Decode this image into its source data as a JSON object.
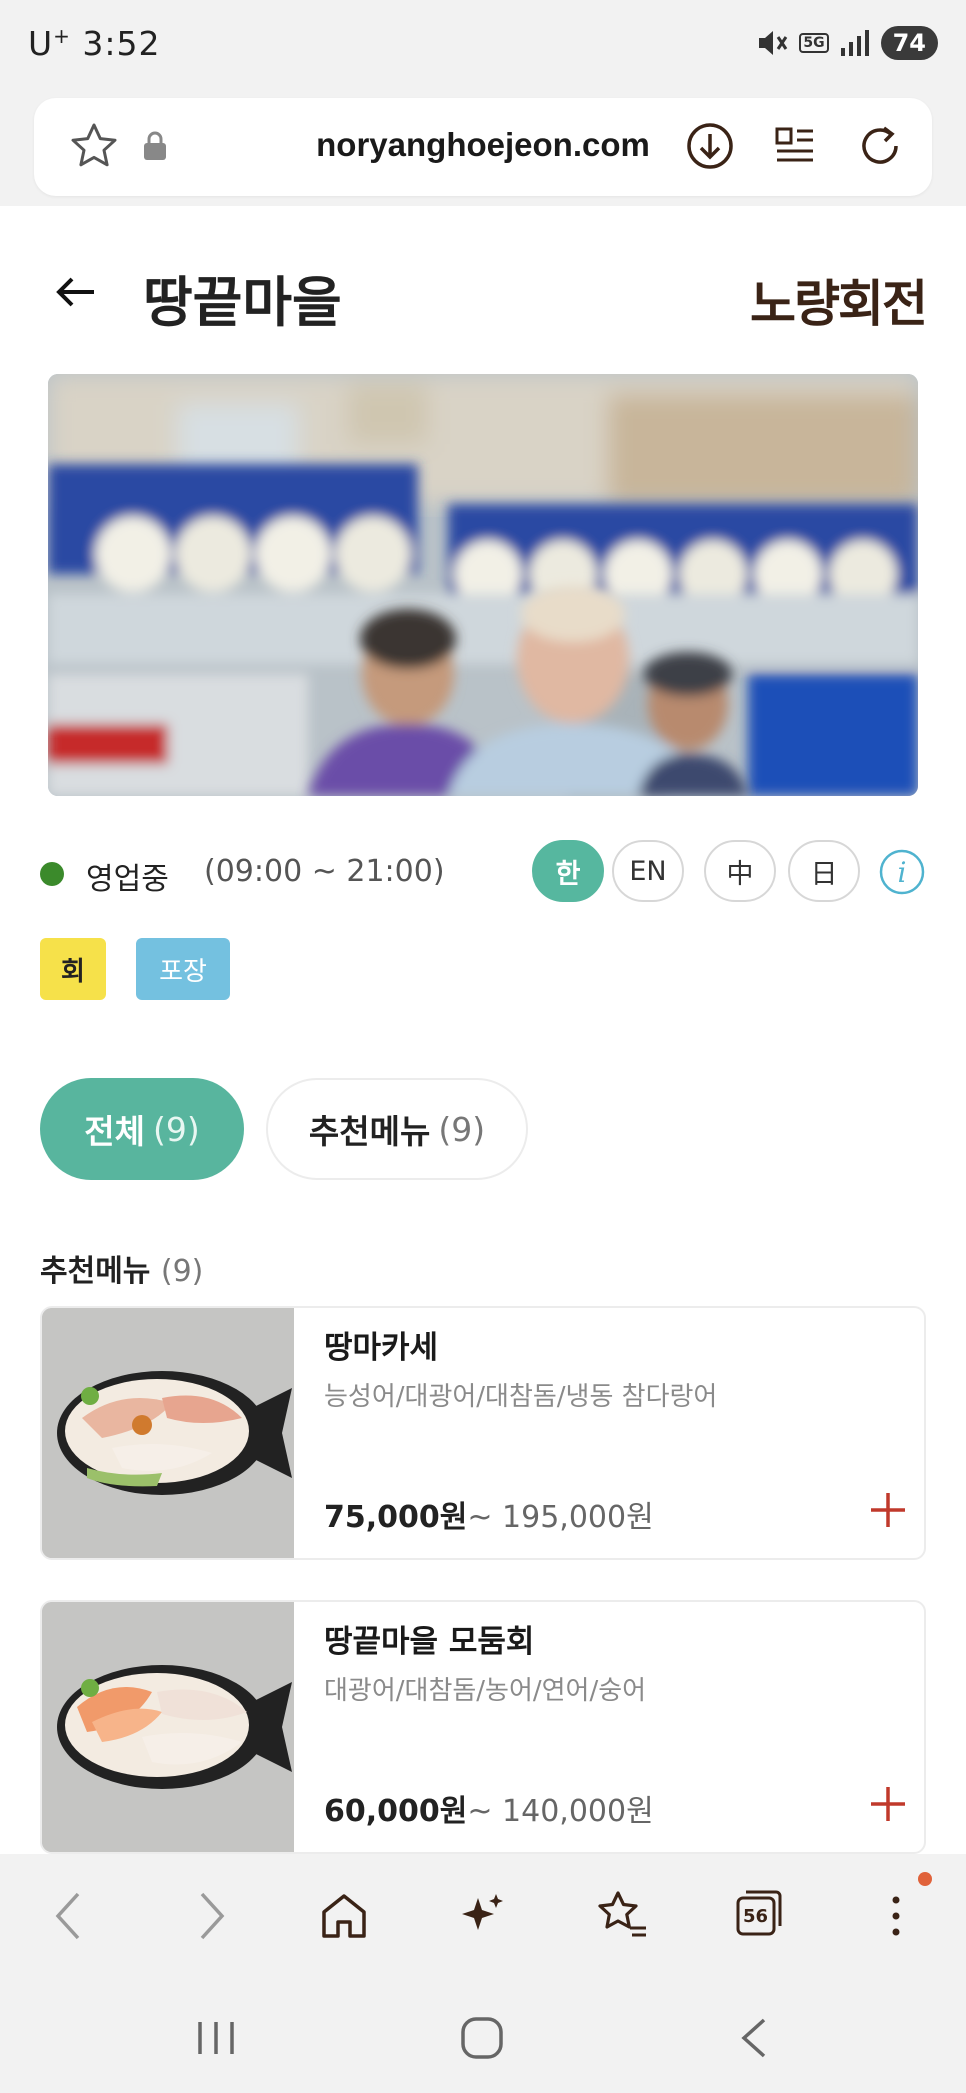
{
  "status_bar": {
    "carrier": "U",
    "carrier_plus": "+",
    "time": "3:52",
    "network": "5G",
    "battery": "74"
  },
  "browser": {
    "url": "noryanghoejeon.com",
    "tab_count": "56"
  },
  "header": {
    "title": "땅끝마을",
    "brand": "노량회전"
  },
  "store": {
    "status": "영업중",
    "hours": "(09:00 ~ 21:00)",
    "languages": [
      "한",
      "EN",
      "中",
      "日"
    ],
    "active_language": "한",
    "tags": [
      "회",
      "포장"
    ]
  },
  "filters": {
    "all_label": "전체",
    "all_count": "(9)",
    "recommended_label": "추천메뉴",
    "recommended_count": "(9)"
  },
  "section": {
    "title": "추천메뉴",
    "count": "(9)"
  },
  "menu_items": [
    {
      "name": "땅마카세",
      "description": "능성어/대광어/대참돔/냉동 참다랑어",
      "price_min": "75,000원",
      "price_max": "~ 195,000원"
    },
    {
      "name": "땅끝마을 모둠회",
      "description": "대광어/대참돔/농어/연어/숭어",
      "price_min": "60,000원",
      "price_max": "~ 140,000원"
    }
  ],
  "colors": {
    "accent": "#56b79f",
    "brand": "#3a2316",
    "add": "#c0392b",
    "open": "#3b8a2b"
  }
}
